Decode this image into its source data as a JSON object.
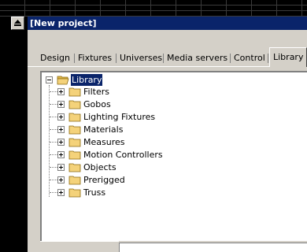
{
  "window": {
    "title": "[New project]"
  },
  "tabs": [
    {
      "label": "Design",
      "active": false
    },
    {
      "label": "Fixtures",
      "active": false
    },
    {
      "label": "Universes",
      "active": false
    },
    {
      "label": "Media servers",
      "active": false
    },
    {
      "label": "Control",
      "active": false
    },
    {
      "label": "Library",
      "active": true
    }
  ],
  "tree": {
    "root": {
      "label": "Library",
      "expanded": true,
      "selected": true,
      "icon": "folder-open-icon"
    },
    "children": [
      {
        "label": "Filters",
        "icon": "folder-icon"
      },
      {
        "label": "Gobos",
        "icon": "folder-icon"
      },
      {
        "label": "Lighting Fixtures",
        "icon": "folder-icon"
      },
      {
        "label": "Materials",
        "icon": "folder-icon"
      },
      {
        "label": "Measures",
        "icon": "folder-icon"
      },
      {
        "label": "Motion Controllers",
        "icon": "folder-icon"
      },
      {
        "label": "Objects",
        "icon": "folder-icon"
      },
      {
        "label": "Prerigged",
        "icon": "folder-icon"
      },
      {
        "label": "Truss",
        "icon": "folder-icon"
      }
    ]
  },
  "colors": {
    "titlebar": "#0a246a",
    "face": "#d4d0c8",
    "selection": "#0a246a",
    "folder": "#f4d27a"
  }
}
